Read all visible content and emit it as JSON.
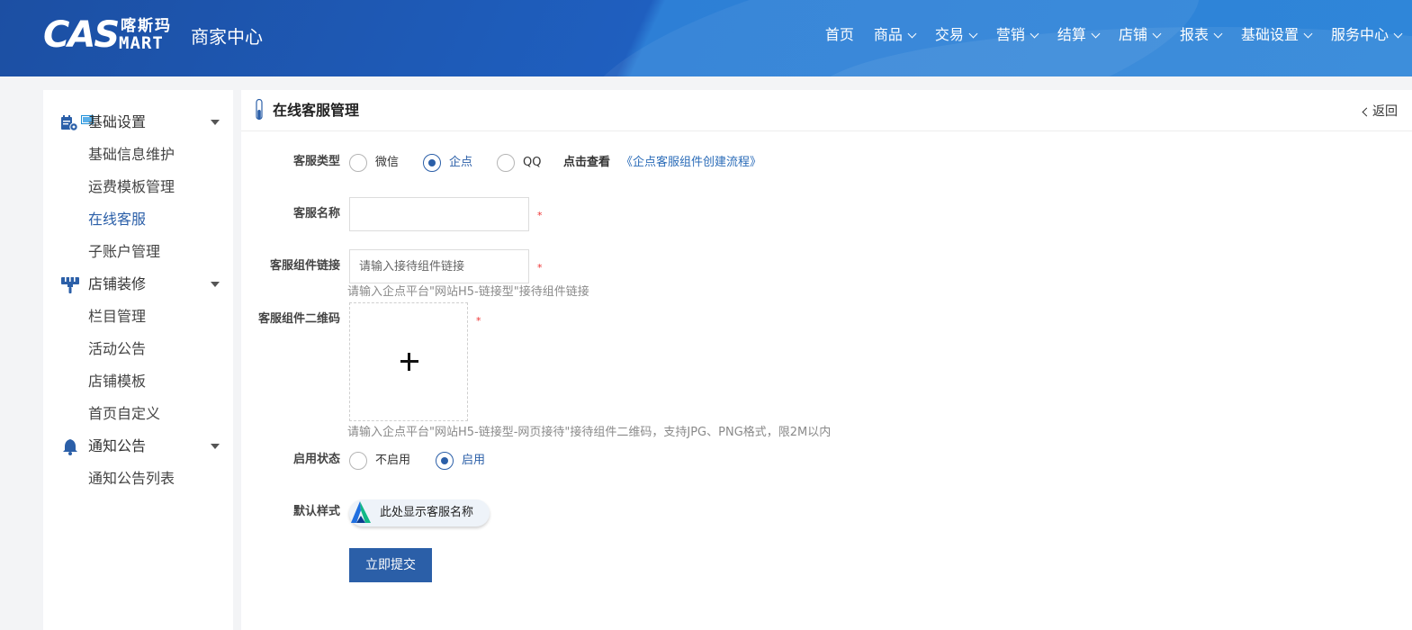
{
  "header": {
    "logo_cas": "CAS",
    "logo_cn": "喀斯玛",
    "logo_en": "MART",
    "logo_sub": "商家中心",
    "nav": [
      {
        "label": "首页",
        "dropdown": false
      },
      {
        "label": "商品",
        "dropdown": true
      },
      {
        "label": "交易",
        "dropdown": true
      },
      {
        "label": "营销",
        "dropdown": true
      },
      {
        "label": "结算",
        "dropdown": true
      },
      {
        "label": "店铺",
        "dropdown": true
      },
      {
        "label": "报表",
        "dropdown": true
      },
      {
        "label": "基础设置",
        "dropdown": true
      },
      {
        "label": "服务中心",
        "dropdown": true
      }
    ]
  },
  "sidebar": {
    "groups": [
      {
        "label": "基础设置",
        "icon": "settings-calendar-icon",
        "items": [
          "基础信息维护",
          "运费模板管理",
          "在线客服",
          "子账户管理"
        ]
      },
      {
        "label": "店铺装修",
        "icon": "paint-brush-icon",
        "items": [
          "栏目管理",
          "活动公告",
          "店铺模板",
          "首页自定义"
        ]
      },
      {
        "label": "通知公告",
        "icon": "bell-icon",
        "items": [
          "通知公告列表"
        ]
      }
    ],
    "active_item": "在线客服"
  },
  "main": {
    "title": "在线客服管理",
    "back_label": "返回",
    "form": {
      "type_label": "客服类型",
      "type_options": [
        "微信",
        "企点",
        "QQ"
      ],
      "type_selected": "企点",
      "type_view_prefix": "点击查看",
      "type_view_link": "《企点客服组件创建流程》",
      "name_label": "客服名称",
      "name_value": "",
      "link_label": "客服组件链接",
      "link_placeholder": "请输入接待组件链接",
      "link_hint": "请输入企点平台\"网站H5-链接型\"接待组件链接",
      "qr_label": "客服组件二维码",
      "qr_hint": "请输入企点平台\"网站H5-链接型-网页接待\"接待组件二维码，支持JPG、PNG格式，限2M以内",
      "required_mark": "*",
      "status_label": "启用状态",
      "status_options": [
        "不启用",
        "启用"
      ],
      "status_selected": "启用",
      "style_label": "默认样式",
      "style_preview_text": "此处显示客服名称",
      "submit_label": "立即提交"
    }
  },
  "colors": {
    "header_bg": "#1f5fbf",
    "accent": "#2b5fa8",
    "link": "#2b6cb8",
    "required": "#e33333"
  }
}
